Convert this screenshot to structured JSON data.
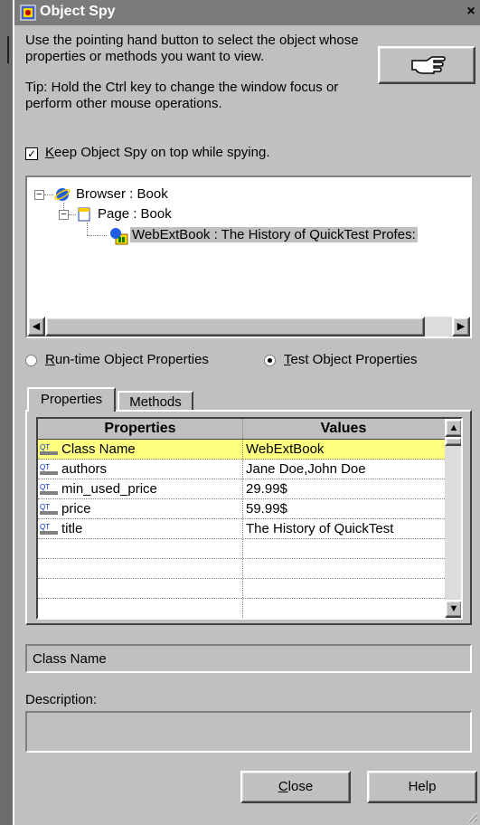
{
  "window": {
    "title": "Object Spy",
    "close_glyph": "×"
  },
  "instructions": {
    "main": "Use the pointing hand button to select the object whose properties or methods you want to view.",
    "tip": "Tip: Hold the Ctrl key to change the window focus or perform other mouse operations.",
    "pointing_hand_icon": "pointing-hand-icon"
  },
  "keep_on_top": {
    "label_prefix": "K",
    "label_rest": "eep Object Spy on top while spying.",
    "checked": true
  },
  "tree": {
    "nodes": [
      {
        "label": "Browser : Book",
        "icon": "browser-icon",
        "expander": "−"
      },
      {
        "label": "Page : Book",
        "icon": "page-icon",
        "expander": "−"
      },
      {
        "label": "WebExtBook : The History of QuickTest Profes:",
        "icon": "webext-icon",
        "selected": true
      }
    ]
  },
  "property_mode": {
    "options": [
      {
        "prefix": "R",
        "rest": "un-time Object Properties",
        "selected": false
      },
      {
        "prefix": "T",
        "rest": "est Object Properties",
        "selected": true
      }
    ]
  },
  "tabs": [
    "Properties",
    "Methods"
  ],
  "grid": {
    "columns": [
      "Properties",
      "Values"
    ],
    "rows": [
      {
        "property": "Class Name",
        "value": "WebExtBook",
        "selected": true
      },
      {
        "property": "authors",
        "value": "Jane Doe,John Doe"
      },
      {
        "property": "min_used_price",
        "value": "29.99$"
      },
      {
        "property": "price",
        "value": "59.99$"
      },
      {
        "property": "title",
        "value": "The History of QuickTest"
      }
    ]
  },
  "selected_property_name": "Class Name",
  "description": {
    "label": "Description:",
    "text": ""
  },
  "buttons": {
    "close_prefix": "C",
    "close_rest": "lose",
    "help": "Help"
  },
  "colors": {
    "selection_highlight": "#ffff80",
    "window_bg": "#c0c0c0",
    "titlebar_bg": "#7b7b7b"
  }
}
